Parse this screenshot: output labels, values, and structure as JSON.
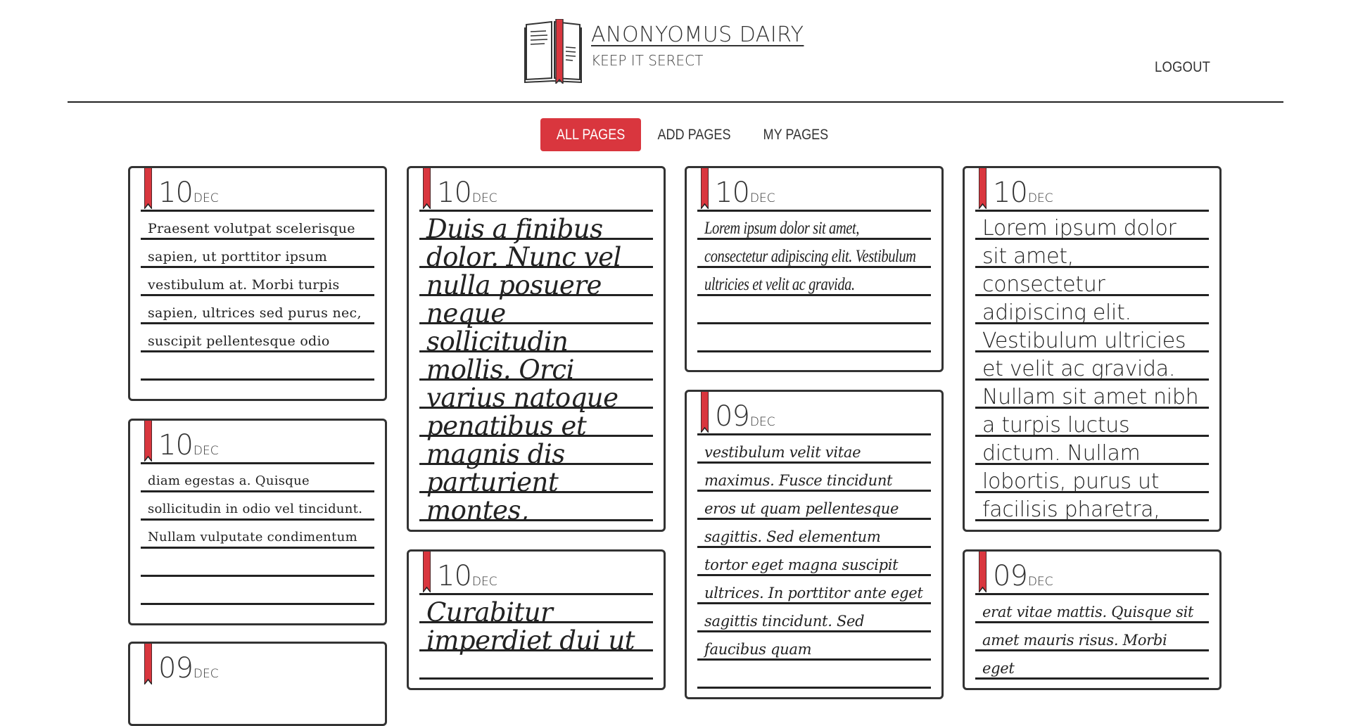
{
  "brand": {
    "title": "ANONYOMUS DAIRY",
    "subtitle": "KEEP IT SERECT",
    "logo_icon": "open-book-icon"
  },
  "header": {
    "logout_label": "LOGOUT"
  },
  "nav": {
    "items": [
      {
        "label": "ALL PAGES",
        "active": true
      },
      {
        "label": "ADD PAGES",
        "active": false
      },
      {
        "label": "MY PAGES",
        "active": false
      }
    ]
  },
  "colors": {
    "accent": "#d9363e",
    "ink": "#222222",
    "border": "#333333"
  },
  "cards": [
    {
      "day": "10",
      "month": "DEC",
      "text": "Praesent volutpat scelerisque sapien, ut porttitor ipsum vestibulum at. Morbi turpis sapien, ultrices sed purus nec, suscipit pellentesque odio"
    },
    {
      "day": "10",
      "month": "DEC",
      "text": "diam egestas a. Quisque sollicitudin in odio vel tincidunt. Nullam vulputate condimentum"
    },
    {
      "day": "09",
      "month": "DEC",
      "text": ""
    },
    {
      "day": "10",
      "month": "DEC",
      "text": "Duis a finibus dolor. Nunc vel nulla posuere neque sollicitudin mollis. Orci varius natoque penatibus et magnis dis parturient montes, nascetur ridiculus"
    },
    {
      "day": "10",
      "month": "DEC",
      "text": "Curabitur imperdiet dui ut"
    },
    {
      "day": "10",
      "month": "DEC",
      "text": "Lorem ipsum dolor sit amet, consectetur adipiscing elit. Vestibulum ultricies et velit ac gravida."
    },
    {
      "day": "09",
      "month": "DEC",
      "text": "vestibulum velit vitae maximus. Fusce tincidunt eros ut quam pellentesque sagittis. Sed elementum tortor eget magna suscipit ultrices. In porttitor ante eget sagittis tincidunt. Sed faucibus quam"
    },
    {
      "day": "10",
      "month": "DEC",
      "text": "Lorem ipsum dolor sit amet, consectetur adipiscing elit. Vestibulum ultricies et velit ac gravida. Nullam sit amet nibh a turpis luctus dictum. Nullam lobortis, purus ut facilisis pharetra,"
    },
    {
      "day": "09",
      "month": "DEC",
      "text": "erat vitae mattis. Quisque sit amet mauris risus. Morbi eget"
    }
  ]
}
